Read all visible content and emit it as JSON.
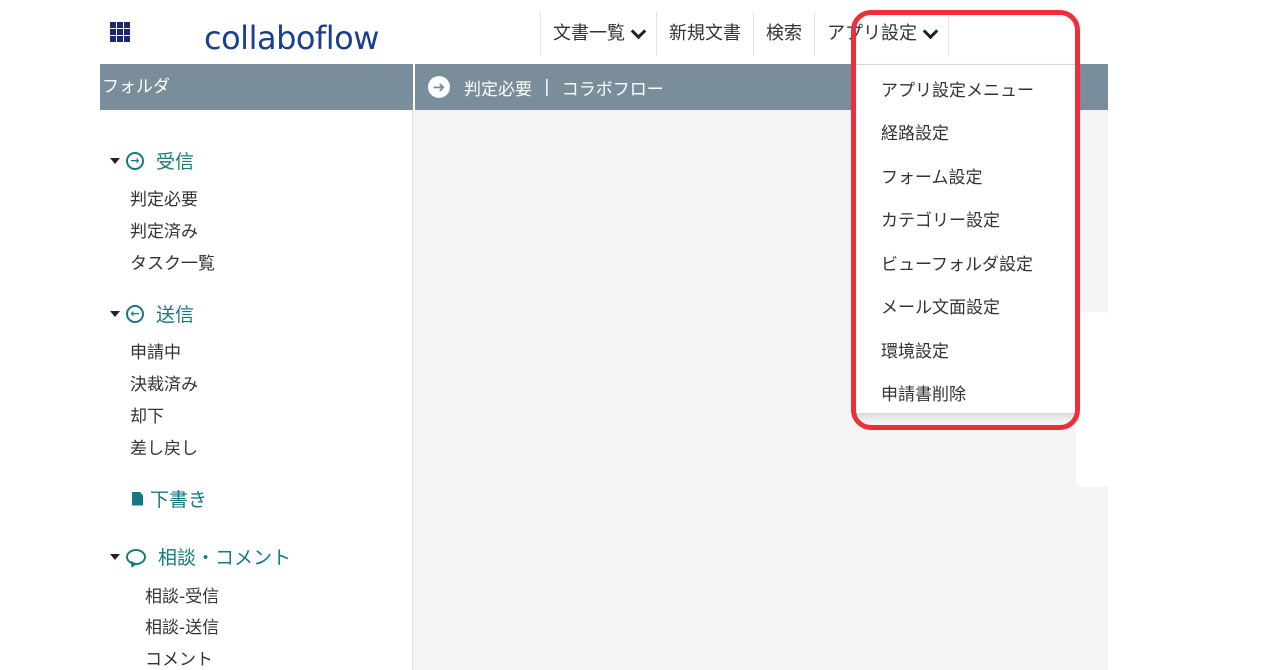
{
  "header": {
    "apps_icon": "grid-icon",
    "logo": "collaboflow",
    "nav": [
      {
        "label": "文書一覧",
        "has_dropdown": true
      },
      {
        "label": "新規文書",
        "has_dropdown": false
      },
      {
        "label": "検索",
        "has_dropdown": false
      },
      {
        "label": "アプリ設定",
        "has_dropdown": true
      }
    ]
  },
  "sidebar": {
    "header": "フォルダ",
    "sections": {
      "inbox": {
        "title": "受信",
        "icon": "arrow-right-circle-icon",
        "items": [
          "判定必要",
          "判定済み",
          "タスク一覧"
        ]
      },
      "outbox": {
        "title": "送信",
        "icon": "arrow-left-circle-icon",
        "items": [
          "申請中",
          "決裁済み",
          "却下",
          "差し戻し"
        ]
      },
      "draft": {
        "title": "下書き",
        "icon": "document-icon"
      },
      "consult": {
        "title": "相談・コメント",
        "icon": "chat-bubble-icon",
        "items": [
          "相談-受信",
          "相談-送信",
          "コメント"
        ]
      }
    }
  },
  "breadcrumb": {
    "icon": "arrow-right-circle-icon",
    "current": "判定必要",
    "separator": "|",
    "app": "コラボフロー"
  },
  "dropdown": {
    "items": [
      "アプリ設定メニュー",
      "経路設定",
      "フォーム設定",
      "カテゴリー設定",
      "ビューフォルダ設定",
      "メール文面設定",
      "環境設定",
      "申請書削除"
    ]
  },
  "colors": {
    "accent": "#157a80",
    "header_strip": "#7a8d9a",
    "highlight": "#ee2e3a",
    "logo": "#1a3f8f"
  }
}
